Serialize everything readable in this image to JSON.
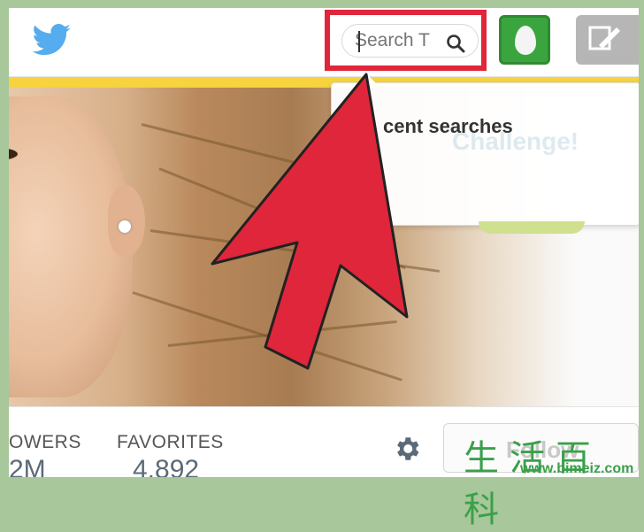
{
  "header": {
    "search": {
      "placeholder": "Search T"
    }
  },
  "dropdown": {
    "title": "cent searches",
    "ghost_text": "Challenge!"
  },
  "stats": {
    "followers_label": "OWERS",
    "followers_value": "2M",
    "favorites_label": "FAVORITES",
    "favorites_value": "4,892"
  },
  "follow_button": {
    "label": "Follow"
  },
  "watermark": {
    "chars": "生活百科",
    "url": "www.bimeiz.com"
  },
  "colors": {
    "highlight_red": "#e0263a",
    "twitter_blue": "#55acee",
    "avatar_green": "#3aa53e",
    "banner_yellow": "#f7d33d",
    "frame_green": "#a8c79a"
  },
  "icons": [
    "twitter-bird-icon",
    "search-icon",
    "egg-avatar-icon",
    "compose-tweet-icon",
    "gear-icon"
  ]
}
